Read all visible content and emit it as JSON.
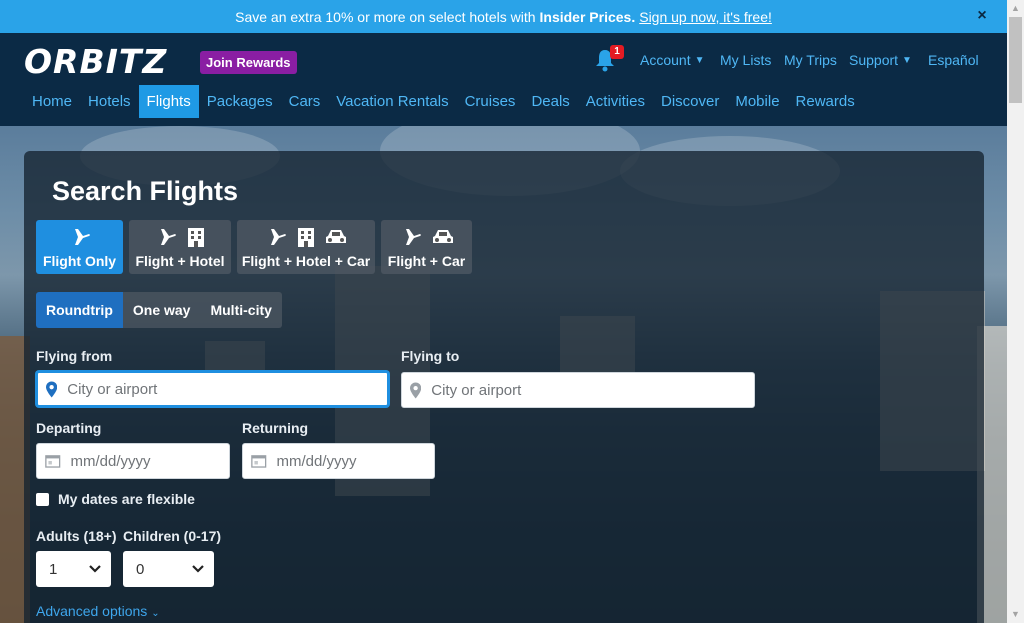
{
  "promo": {
    "text": "Save an extra 10% or more on select hotels with",
    "bold": "Insider Prices.",
    "link": "Sign up now, it's free!",
    "close": "×"
  },
  "header": {
    "logo": "ORBITZ",
    "rewards_badge": "Join Rewards",
    "notification_count": "1",
    "top_links": [
      "Account",
      "My Lists",
      "My Trips",
      "Support",
      "Español"
    ],
    "nav": [
      "Home",
      "Hotels",
      "Flights",
      "Packages",
      "Cars",
      "Vacation Rentals",
      "Cruises",
      "Deals",
      "Activities",
      "Discover",
      "Mobile",
      "Rewards"
    ],
    "active_nav": "Flights"
  },
  "search": {
    "title": "Search Flights",
    "product_tabs": [
      "Flight Only",
      "Flight + Hotel",
      "Flight + Hotel + Car",
      "Flight + Car"
    ],
    "trip_tabs": [
      "Roundtrip",
      "One way",
      "Multi-city"
    ],
    "flying_from_label": "Flying from",
    "flying_from_placeholder": "City or airport",
    "flying_to_label": "Flying to",
    "flying_to_placeholder": "City or airport",
    "departing_label": "Departing",
    "departing_placeholder": "mm/dd/yyyy",
    "returning_label": "Returning",
    "returning_placeholder": "mm/dd/yyyy",
    "flexible_label": "My dates are flexible",
    "adults_label": "Adults (18+)",
    "adults_value": "1",
    "children_label": "Children (0-17)",
    "children_value": "0",
    "advanced": "Advanced options"
  },
  "colors": {
    "banner": "#2aa3e8",
    "header_bg": "#0b2a45",
    "nav_link": "#4fb7f5",
    "active_tab": "#1f8fe0",
    "rewards": "#8a1ea3"
  },
  "icons": [
    "plane-icon",
    "hotel-icon",
    "car-icon",
    "bell-icon",
    "pin-icon",
    "calendar-icon",
    "chevron-down-icon",
    "close-icon"
  ]
}
